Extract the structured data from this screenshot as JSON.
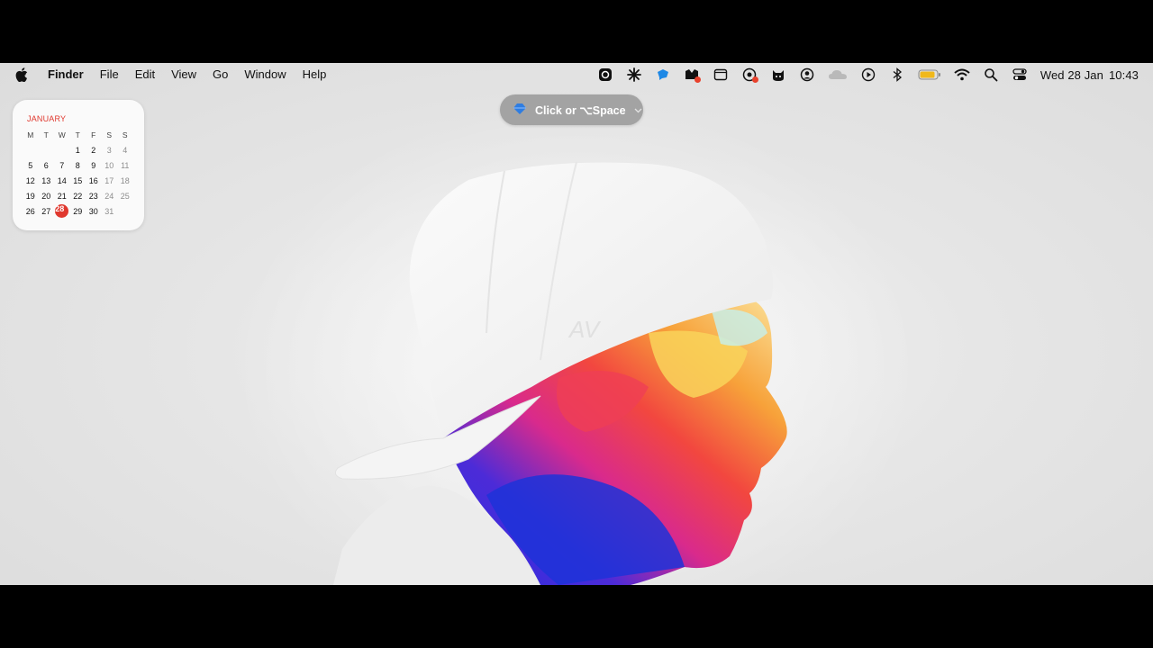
{
  "menubar": {
    "apple_icon": "apple-logo-icon",
    "app_name": "Finder",
    "items": [
      {
        "label": "File"
      },
      {
        "label": "Edit"
      },
      {
        "label": "View"
      },
      {
        "label": "Go"
      },
      {
        "label": "Window"
      },
      {
        "label": "Help"
      }
    ],
    "status_icons": [
      "app-icon",
      "sparkle-icon",
      "chat-bubble-icon",
      "mail-icon",
      "window-icon",
      "vpn-icon",
      "cat-icon",
      "user-circle-icon",
      "cloud-icon",
      "play-icon",
      "bluetooth-icon",
      "battery-icon",
      "wifi-icon",
      "search-icon",
      "control-center-icon"
    ],
    "battery_color": "#f0b81a",
    "clock": {
      "date": "Wed 28 Jan",
      "time": "10:43"
    }
  },
  "pill": {
    "label": "Click or ⌥Space",
    "icon": "diamond-icon"
  },
  "calendar": {
    "month": "JANUARY",
    "weekdays": [
      "M",
      "T",
      "W",
      "T",
      "F",
      "S",
      "S"
    ],
    "weeks": [
      [
        "",
        "",
        "",
        "1",
        "2",
        "3",
        "4"
      ],
      [
        "5",
        "6",
        "7",
        "8",
        "9",
        "10",
        "11"
      ],
      [
        "12",
        "13",
        "14",
        "15",
        "16",
        "17",
        "18"
      ],
      [
        "19",
        "20",
        "21",
        "22",
        "23",
        "24",
        "25"
      ],
      [
        "26",
        "27",
        "28",
        "29",
        "30",
        "31",
        ""
      ]
    ],
    "today": "28",
    "accent": "#e0382e"
  }
}
